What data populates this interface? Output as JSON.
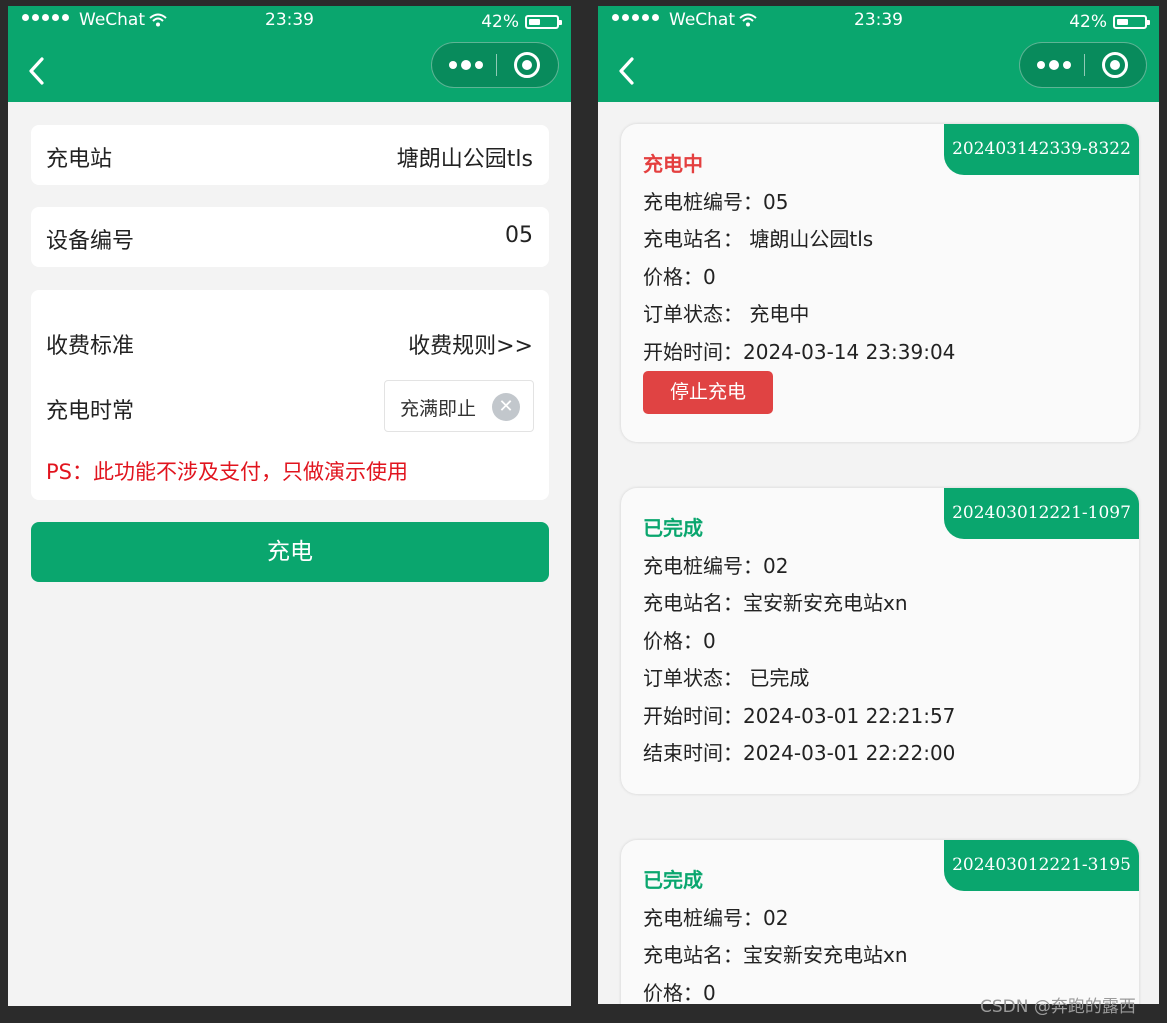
{
  "status_bar": {
    "carrier": "WeChat",
    "time": "23:39",
    "battery": "42%",
    "battery_level": 0.42
  },
  "form": {
    "station_label": "充电站",
    "station_value": "塘朗山公园tls",
    "device_label": "设备编号",
    "device_value": "05",
    "fee_label": "收费标准",
    "fee_link": "收费规则>>",
    "duration_label": "充电时常",
    "duration_value": "充满即止",
    "ps_note": "PS：此功能不涉及支付，只做演示使用",
    "charge_button": "充电"
  },
  "orders": [
    {
      "id": "202403142339-8322",
      "status": "充电中",
      "lines": [
        "充电桩编号：05",
        "充电站名： 塘朗山公园tls",
        "价格：0",
        "订单状态： 充电中",
        "开始时间：2024-03-14 23:39:04"
      ],
      "stop_button": "停止充电"
    },
    {
      "id": "202403012221-1097",
      "status": "已完成",
      "lines": [
        "充电桩编号：02",
        "充电站名：宝安新安充电站xn",
        "价格：0",
        "订单状态： 已完成",
        "开始时间：2024-03-01 22:21:57",
        "结束时间：2024-03-01 22:22:00"
      ]
    },
    {
      "id": "202403012221-3195",
      "status": "已完成",
      "lines": [
        "充电桩编号：02",
        "充电站名：宝安新安充电站xn",
        "价格：0"
      ]
    }
  ],
  "colors": {
    "brand_green": "#0aa66e",
    "charging_red": "#e43f3f",
    "done_green": "#0aa66e",
    "stop_red": "#e04343",
    "ps_red": "#e1141e"
  },
  "watermark": "CSDN @奔跑的露西"
}
